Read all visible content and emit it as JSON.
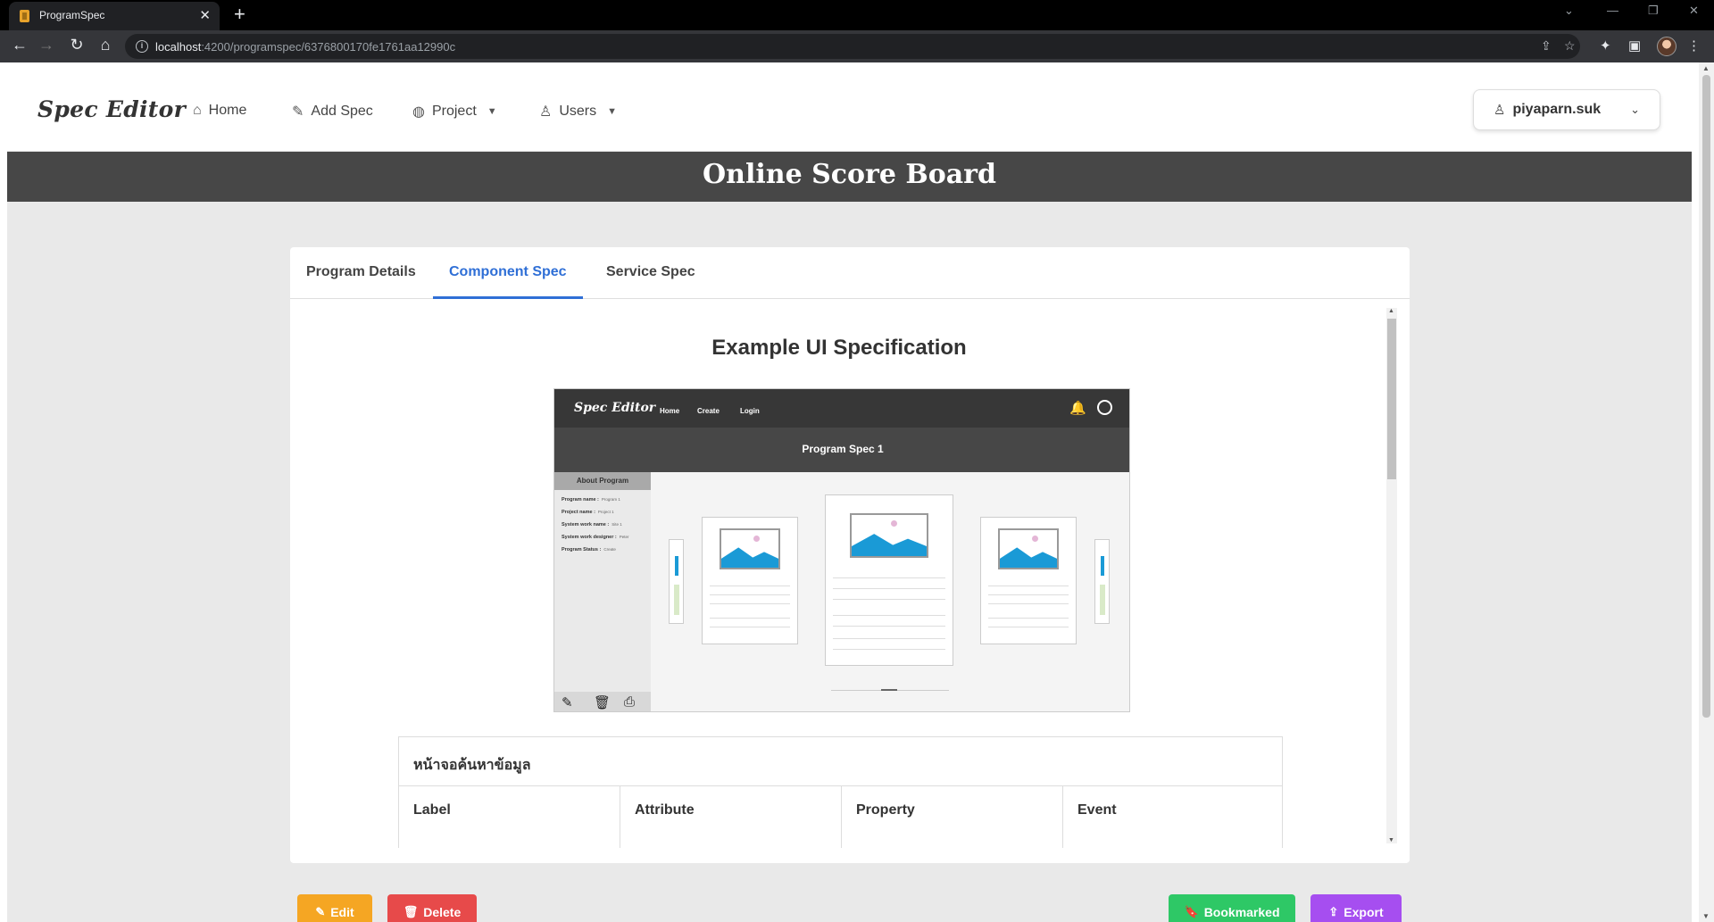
{
  "browser": {
    "tab_title": "ProgramSpec",
    "url_host": "localhost",
    "url_path": ":4200/programspec/6376800170fe1761aa12990c"
  },
  "nav": {
    "brand": "Spec Editor",
    "home": "Home",
    "add_spec": "Add Spec",
    "project": "Project",
    "users": "Users",
    "user_name": "piyaparn.suk"
  },
  "page_title": "Online Score Board",
  "tabs": [
    "Program Details",
    "Component Spec",
    "Service Spec"
  ],
  "active_tab": "Component Spec",
  "section_title": "Example UI Specification",
  "mockup": {
    "brand": "Spec Editor",
    "nav": [
      "Home",
      "Create",
      "Login"
    ],
    "band_title": "Program Spec 1",
    "side_header": "About Program",
    "fields": [
      {
        "label": "Program name :",
        "value": "Program 1"
      },
      {
        "label": "Project name :",
        "value": "Project 1"
      },
      {
        "label": "System work name :",
        "value": "Site 1"
      },
      {
        "label": "System work designer :",
        "value": "Peter"
      },
      {
        "label": "Program Status :",
        "value": "Create"
      }
    ]
  },
  "table": {
    "caption": "หน้าจอค้นหาข้อมูล",
    "headers": [
      "Label",
      "Attribute",
      "Property",
      "Event"
    ]
  },
  "buttons": {
    "edit": "Edit",
    "delete": "Delete",
    "bookmarked": "Bookmarked",
    "export": "Export"
  },
  "colors": {
    "edit": "#f5a623",
    "delete": "#e74a4a",
    "bookmarked": "#2ec866",
    "export": "#a64ef0",
    "active_tab": "#2f6fd6",
    "title_band": "#474747"
  }
}
